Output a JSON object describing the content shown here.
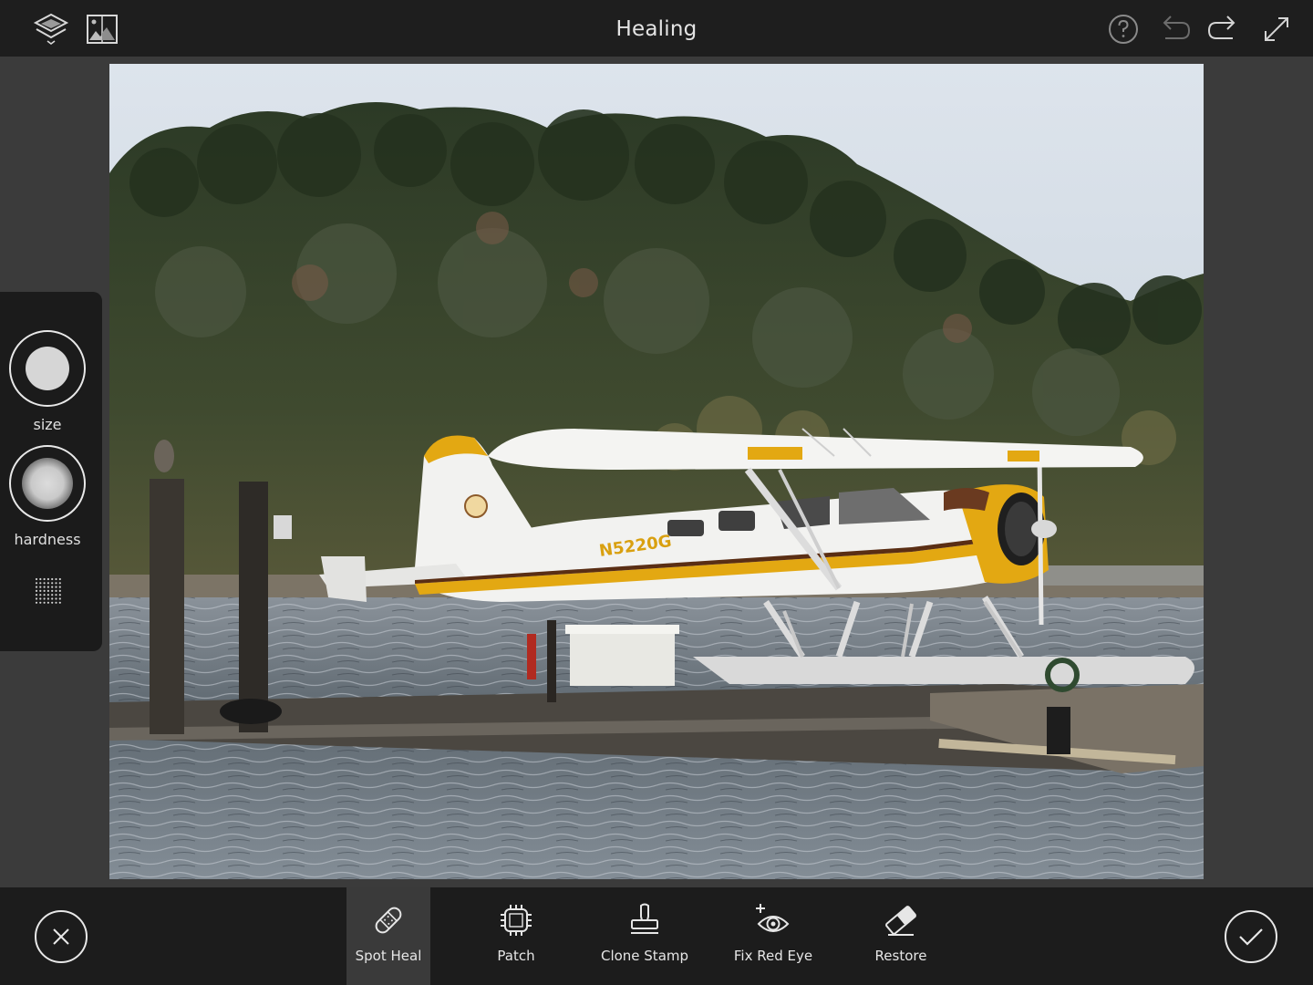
{
  "header": {
    "title": "Healing"
  },
  "brush": {
    "size_label": "size",
    "hardness_label": "hardness"
  },
  "photo": {
    "tail_number": "N5220G"
  },
  "tools": [
    {
      "label": "Spot Heal",
      "active": true
    },
    {
      "label": "Patch",
      "active": false
    },
    {
      "label": "Clone Stamp",
      "active": false
    },
    {
      "label": "Fix Red Eye",
      "active": false
    },
    {
      "label": "Restore",
      "active": false
    }
  ],
  "colors": {
    "bar": "#1e1e1e",
    "stage": "#3b3b3b",
    "active_tool": "#3a3a3a",
    "plane_accent": "#e3a812"
  }
}
